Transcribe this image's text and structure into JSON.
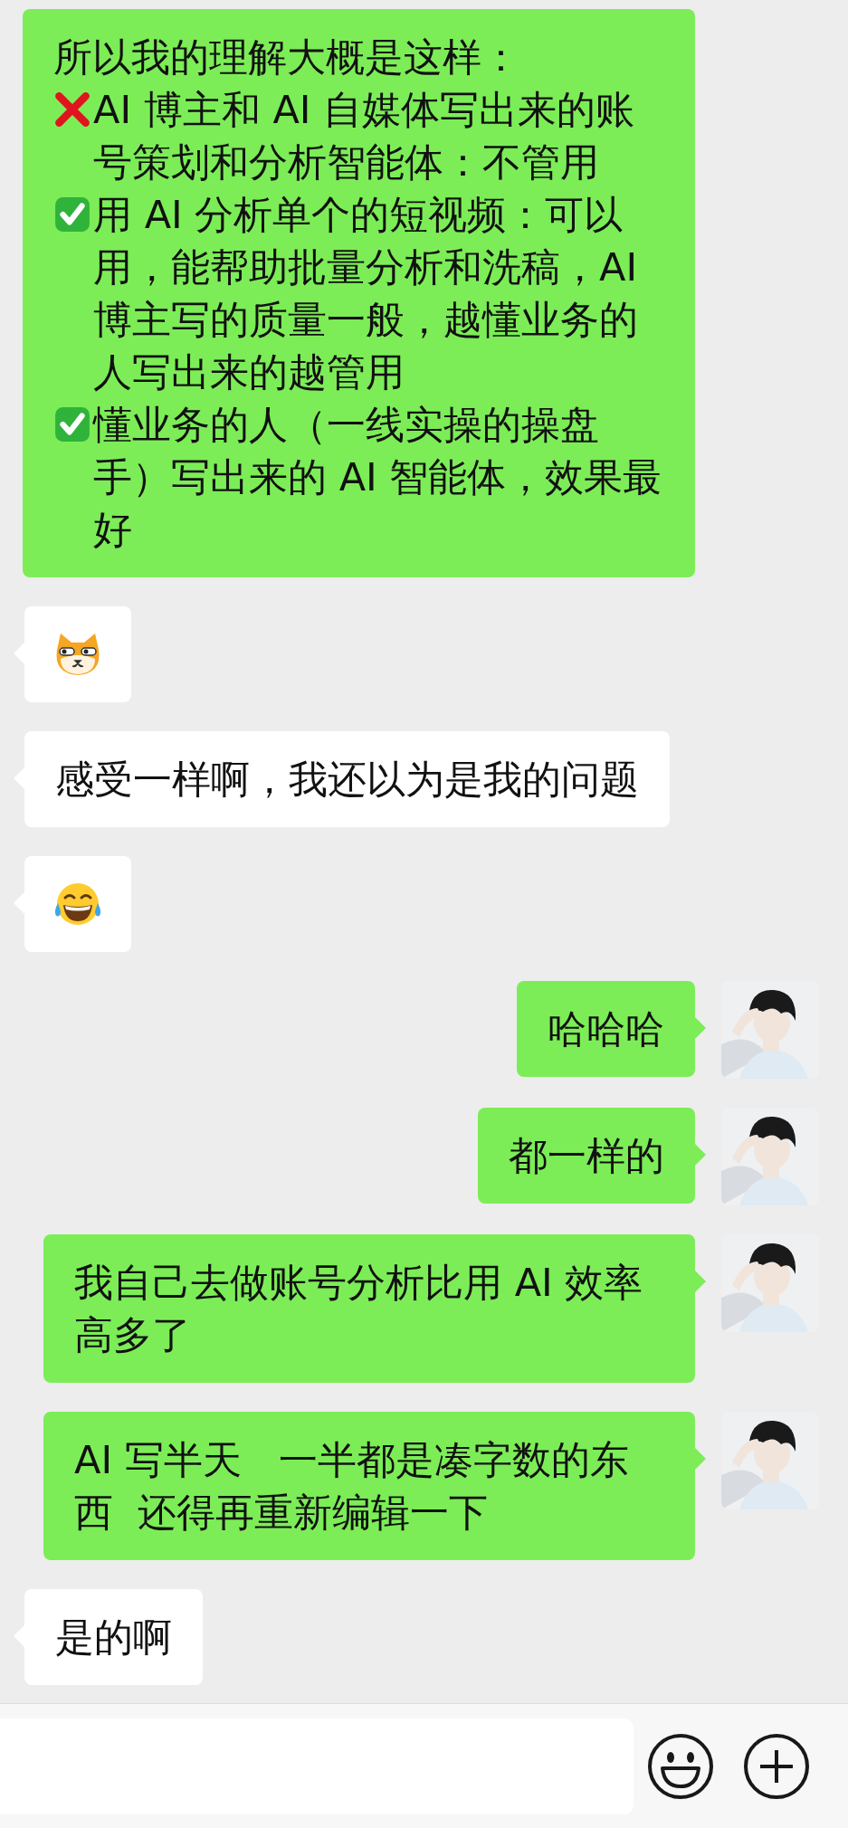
{
  "messages": [
    {
      "outgoing": true,
      "kind": "text",
      "avatar_shown": false,
      "paragraphs": [
        {
          "kind": "plain",
          "text": "所以我的理解大概是这样："
        },
        {
          "kind": "cross",
          "text": "AI 博主和 AI 自媒体写出来的账号策划和分析智能体：不管用"
        },
        {
          "kind": "check",
          "text": "用 AI 分析单个的短视频：可以用，能帮助批量分析和洗稿，AI 博主写的质量一般，越懂业务的人写出来的越管用"
        },
        {
          "kind": "check",
          "text": "懂业务的人（一线实操的操盘手）写出来的 AI 智能体，效果最好"
        }
      ]
    },
    {
      "outgoing": false,
      "kind": "cat"
    },
    {
      "outgoing": false,
      "kind": "text",
      "paragraphs": [
        {
          "kind": "plain",
          "text": "感受一样啊，我还以为是我的问题"
        }
      ]
    },
    {
      "outgoing": false,
      "kind": "laugh"
    },
    {
      "outgoing": true,
      "kind": "text",
      "avatar_shown": true,
      "paragraphs": [
        {
          "kind": "plain",
          "text": "哈哈哈"
        }
      ]
    },
    {
      "outgoing": true,
      "kind": "text",
      "avatar_shown": true,
      "paragraphs": [
        {
          "kind": "plain",
          "text": "都一样的"
        }
      ]
    },
    {
      "outgoing": true,
      "kind": "text",
      "avatar_shown": true,
      "paragraphs": [
        {
          "kind": "plain",
          "text": "我自己去做账号分析比用 AI 效率高多了"
        }
      ]
    },
    {
      "outgoing": true,
      "kind": "text",
      "avatar_shown": true,
      "paragraphs": [
        {
          "kind": "plain",
          "text": "AI 写半天   一半都是凑字数的东西  还得再重新编辑一下"
        }
      ]
    },
    {
      "outgoing": false,
      "kind": "text",
      "paragraphs": [
        {
          "kind": "plain",
          "text": "是的啊"
        }
      ]
    }
  ],
  "input_bar": {
    "buttons": [
      {
        "kind": "emoji"
      },
      {
        "kind": "plus"
      }
    ]
  }
}
